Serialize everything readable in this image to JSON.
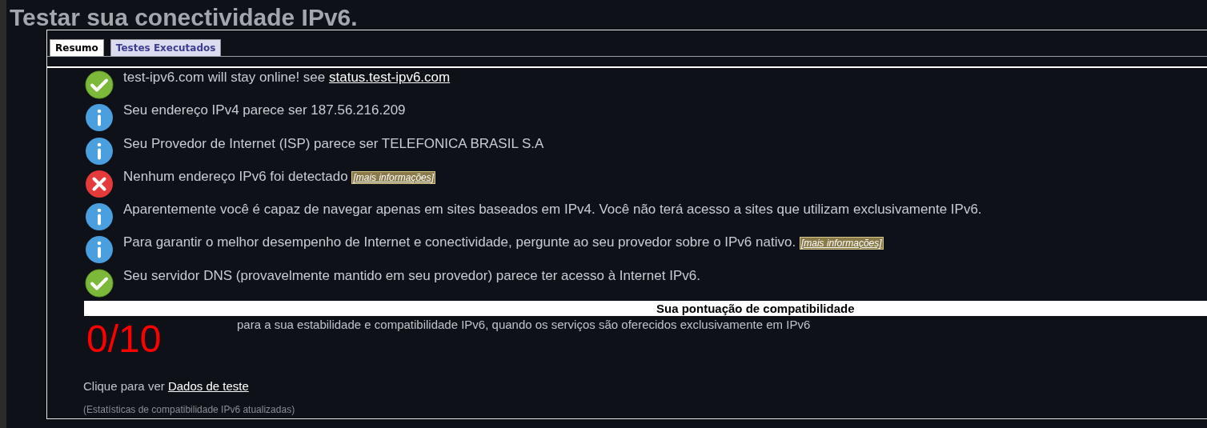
{
  "title": "Testar sua conectividade IPv6.",
  "tabs": [
    {
      "label": "Resumo",
      "selected": true
    },
    {
      "label": "Testes Executados",
      "selected": false
    }
  ],
  "messages": [
    {
      "kind": "ok",
      "text": "test-ipv6.com will stay online! see",
      "link": {
        "kind": "plain",
        "label": "status.test-ipv6.com"
      }
    },
    {
      "kind": "info",
      "text": "Seu endereço IPv4 parece ser 187.56.216.209"
    },
    {
      "kind": "info",
      "text": "Seu Provedor de Internet (ISP) parece ser TELEFONICA BRASIL S.A"
    },
    {
      "kind": "error",
      "text": "Nenhum endereço IPv6 foi detectado",
      "link": {
        "kind": "more",
        "label": "[mais informações]"
      }
    },
    {
      "kind": "info",
      "text": "Aparentemente você é capaz de navegar apenas em sites baseados em IPv4. Você não terá acesso a sites que utilizam exclusivamente IPv6."
    },
    {
      "kind": "info",
      "text": "Para garantir o melhor desempenho de Internet e conectividade, pergunte ao seu provedor sobre o IPv6 nativo.",
      "link": {
        "kind": "more",
        "label": "[mais informações]"
      }
    },
    {
      "kind": "ok",
      "text": "Seu servidor DNS (provavelmente mantido em seu provedor) parece ter acesso à Internet IPv6."
    }
  ],
  "score": {
    "heading": "Sua pontuação de compatibilidade",
    "value": "0/10",
    "description": "para a sua estabilidade e compatibilidade IPv6, quando os serviços são oferecidos exclusivamente em IPv6"
  },
  "test_data": {
    "prefix": "Clique para ver",
    "link": "Dados de teste"
  },
  "stats_note": "(Estatísticas de compatibilidade IPv6 atualizadas)"
}
